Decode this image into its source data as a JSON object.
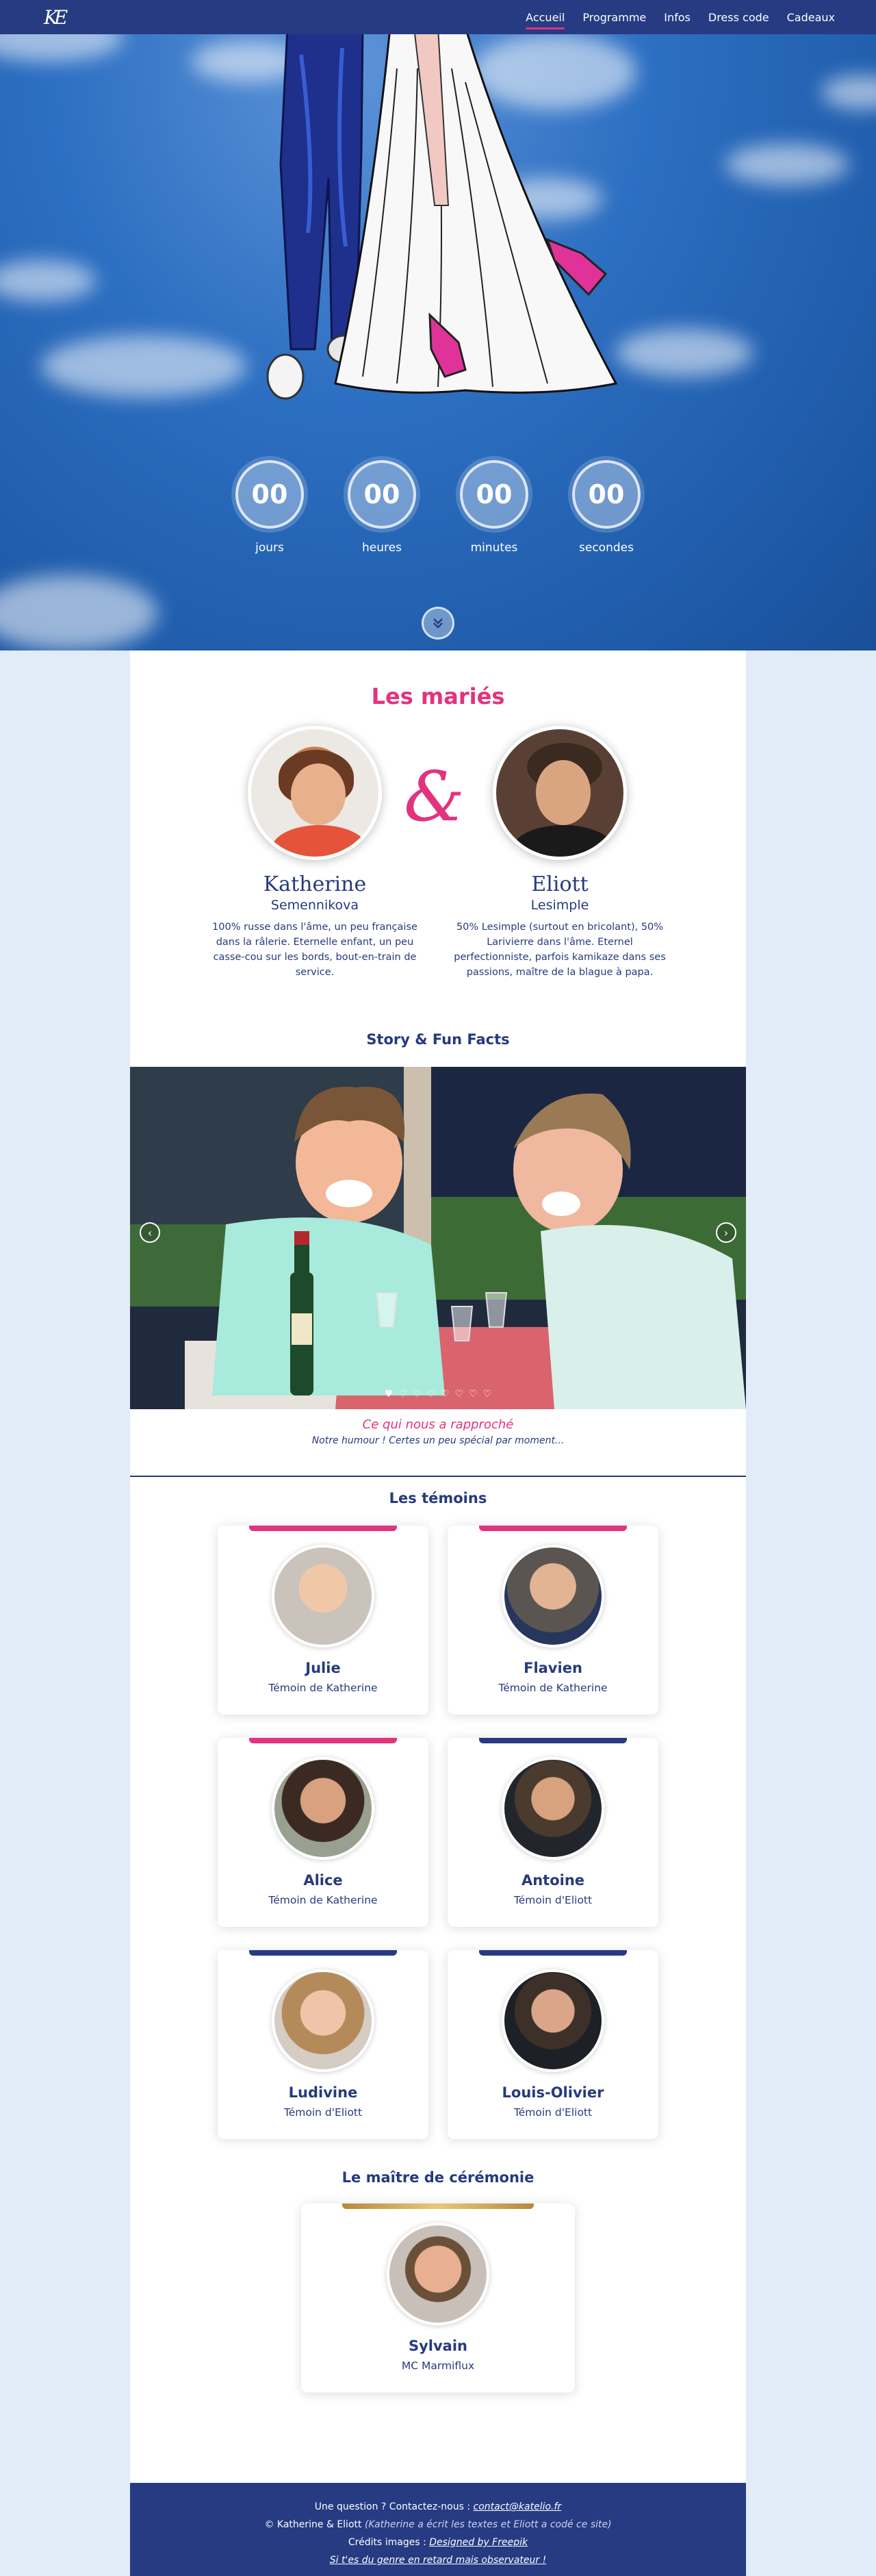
{
  "nav": {
    "logo": "KE",
    "links": [
      {
        "label": "Accueil",
        "active": true
      },
      {
        "label": "Programme",
        "active": false
      },
      {
        "label": "Infos",
        "active": false
      },
      {
        "label": "Dress code",
        "active": false
      },
      {
        "label": "Cadeaux",
        "active": false
      }
    ]
  },
  "countdown": [
    {
      "value": "00",
      "label": "jours"
    },
    {
      "value": "00",
      "label": "heures"
    },
    {
      "value": "00",
      "label": "minutes"
    },
    {
      "value": "00",
      "label": "secondes"
    }
  ],
  "couple": {
    "title": "Les mariés",
    "ampersand": "&",
    "bride": {
      "first_name": "Katherine",
      "last_name": "Semennikova",
      "bio": "100% russe dans l'âme, un peu française dans la râlerie. Eternelle enfant, un peu casse-cou sur les bords, bout-en-train de service."
    },
    "groom": {
      "first_name": "Eliott",
      "last_name": "Lesimple",
      "bio": "50% Lesimple (surtout en bricolant), 50% Larivierre dans l'âme. Eternel perfectionniste, parfois kamikaze dans ses passions, maître de la blague à papa."
    }
  },
  "story": {
    "title": "Story & Fun Facts",
    "caption_title": "Ce qui nous a rapproché",
    "caption_sub": "Notre humour ! Certes un peu spécial par moment...",
    "prev_icon": "chevron-left-icon",
    "next_icon": "chevron-right-icon",
    "slide_count": 8,
    "active_slide": 1
  },
  "witnesses": {
    "title": "Les témoins",
    "people": [
      {
        "name": "Julie",
        "role": "Témoin de Katherine",
        "side": "bride"
      },
      {
        "name": "Flavien",
        "role": "Témoin de Katherine",
        "side": "bride"
      },
      {
        "name": "Alice",
        "role": "Témoin de Katherine",
        "side": "bride"
      },
      {
        "name": "Antoine",
        "role": "Témoin d'Eliott",
        "side": "groom"
      },
      {
        "name": "Ludivine",
        "role": "Témoin d'Eliott",
        "side": "groom"
      },
      {
        "name": "Louis-Olivier",
        "role": "Témoin d'Eliott",
        "side": "groom"
      }
    ]
  },
  "mc": {
    "title": "Le maître de cérémonie",
    "name": "Sylvain",
    "role": "MC Marmiflux"
  },
  "footer": {
    "question": "Une question ? Contactez-nous : ",
    "email": "contact@katelio.fr",
    "copyright": "© Katherine & Eliott ",
    "credit_note": "(Katherine a écrit les textes et Eliott a codé ce site)",
    "images_label": "Crédits images : ",
    "images_link": "Designed by Freepik",
    "late_note": "Si t'es du genre en retard mais observateur !"
  },
  "colors": {
    "navy": "#263b82",
    "pink": "#e2337f",
    "gold": "#c9a24a",
    "sky": "#2d6fc2"
  }
}
